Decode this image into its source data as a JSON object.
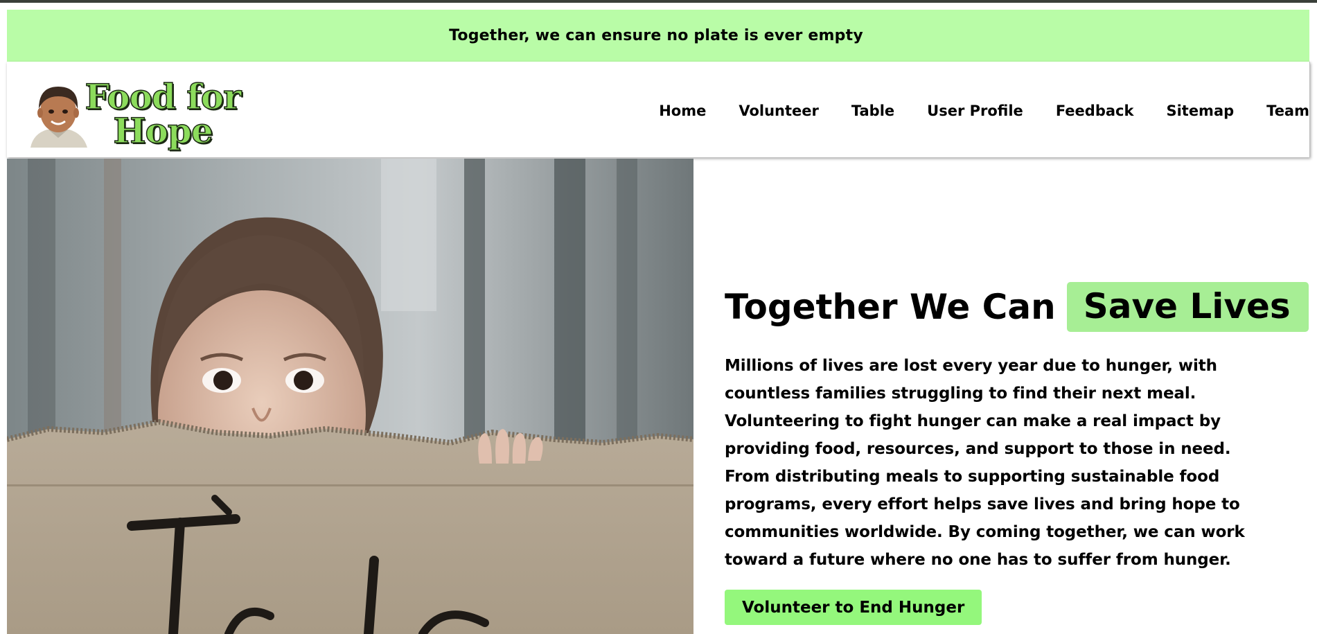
{
  "banner": {
    "text": "Together, we can ensure no plate is ever empty"
  },
  "logo": {
    "line1": "Food for",
    "line2": "Hope"
  },
  "nav": {
    "items": [
      {
        "label": "Home"
      },
      {
        "label": "Volunteer"
      },
      {
        "label": "Table"
      },
      {
        "label": "User Profile"
      },
      {
        "label": "Feedback"
      },
      {
        "label": "Sitemap"
      },
      {
        "label": "Team"
      }
    ]
  },
  "hero": {
    "title": "Together We Can",
    "title_highlight": "Save Lives",
    "body": "Millions of lives are lost every year due to hunger, with countless families struggling to find their next meal. Volunteering to fight hunger can make a real impact by providing food, resources, and support to those in need. From distributing meals to supporting sustainable food programs, every effort helps save lives and bring hope to communities worldwide. By coming together, we can work toward a future where no one has to suffer from hunger.",
    "cta_label": "Volunteer to End Hunger"
  },
  "colors": {
    "banner_bg": "#b9fca7",
    "highlight_bg": "#a7ee95",
    "cta_bg": "#94f77c"
  }
}
